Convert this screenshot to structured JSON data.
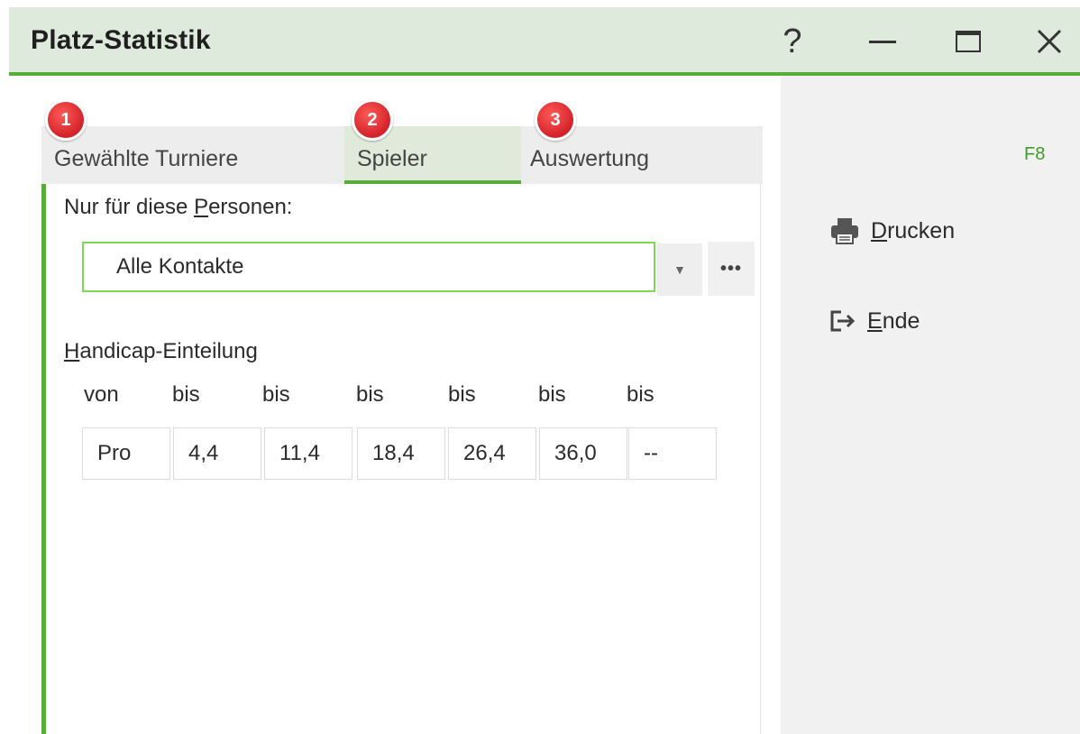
{
  "window": {
    "title": "Platz-Statistik",
    "help_label": "?"
  },
  "tabs": [
    {
      "badge": "1",
      "label": "Gewählte Turniere"
    },
    {
      "badge": "2",
      "label": "Spieler"
    },
    {
      "badge": "3",
      "label": "Auswertung"
    }
  ],
  "persons": {
    "label_before": "Nur für diese ",
    "label_accel": "P",
    "label_after": "ersonen:",
    "selected": "Alle Kontakte",
    "more_label": "•••"
  },
  "handicap": {
    "label_accel": "H",
    "label_after": "andicap-Einteilung",
    "headers": [
      "von",
      "bis",
      "bis",
      "bis",
      "bis",
      "bis",
      "bis"
    ],
    "values": [
      "Pro",
      "4,4",
      "11,4",
      "18,4",
      "26,4",
      "36,0",
      "--"
    ]
  },
  "actions": {
    "print_accel": "D",
    "print_rest": "rucken",
    "print_shortcut": "F8",
    "exit_accel": "E",
    "exit_rest": "nde"
  },
  "colors": {
    "accent": "#58ad3a",
    "titlebar": "#deeadb",
    "badge": "#d3222a"
  }
}
